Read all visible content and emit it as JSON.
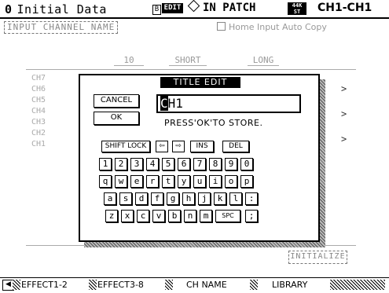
{
  "header": {
    "scene_number": "0",
    "scene_name": "Initial Data",
    "bank_flag": "B",
    "edit_flag": "EDIT",
    "patch_mode": "IN PATCH",
    "rate_top": "44K",
    "rate_bottom": "ST",
    "channel_range": "CH1-CH1"
  },
  "page": {
    "tab_title": "INPUT CHANNEL NAME",
    "autocopy_label": "Home Input Auto Copy"
  },
  "list": {
    "col_headers": [
      "10",
      "SHORT",
      "LONG"
    ],
    "channels": [
      "CH7",
      "CH6",
      "CH5",
      "CH4",
      "CH3",
      "CH2",
      "CH1"
    ],
    "arrow": ">"
  },
  "dialog": {
    "title": "TITLE EDIT",
    "cancel_label": "CANCEL",
    "ok_label": "OK",
    "cursor_char": "C",
    "name_rest": "H1",
    "hint": "PRESS'OK'TO STORE.",
    "shift_lock_label": "SHIFT LOCK",
    "left_arrow": "⇦",
    "right_arrow": "⇨",
    "ins_label": "INS",
    "del_label": "DEL",
    "row_digits": [
      "1",
      "2",
      "3",
      "4",
      "5",
      "6",
      "7",
      "8",
      "9",
      "0"
    ],
    "row_q": [
      "q",
      "w",
      "e",
      "r",
      "t",
      "y",
      "u",
      "i",
      "o",
      "p"
    ],
    "row_a": [
      "a",
      "s",
      "d",
      "f",
      "g",
      "h",
      "j",
      "k",
      "l",
      ":"
    ],
    "row_z": [
      "z",
      "x",
      "c",
      "v",
      "b",
      "n",
      "m"
    ],
    "spc_label": "SPC",
    "row_z_end": ";"
  },
  "footer": {
    "initialize_label": "INITIALIZE",
    "tabs": [
      "◀",
      "EFFECT1-2",
      "EFFECT3-8",
      "CH NAME",
      "LIBRARY"
    ]
  }
}
